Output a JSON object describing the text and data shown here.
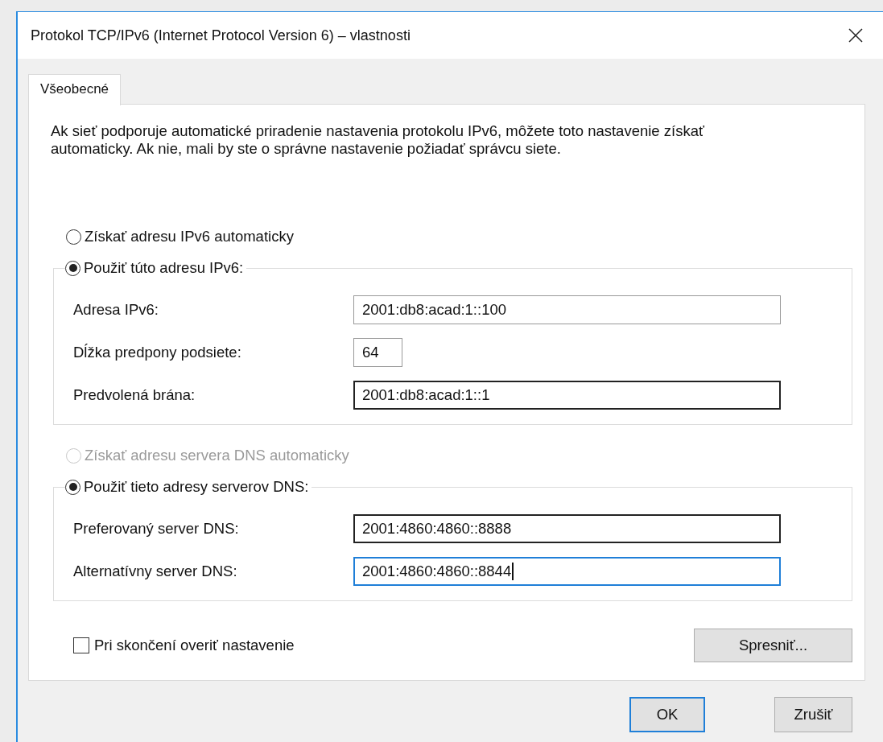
{
  "window": {
    "title": "Protokol TCP/IPv6 (Internet Protocol Version 6) – vlastnosti"
  },
  "tabs": [
    {
      "label": "Všeobecné",
      "selected": true
    }
  ],
  "description": "Ak sieť podporuje automatické priradenie nastavenia protokolu IPv6, môžete toto nastavenie získať automaticky. Ak nie, mali by ste o správne nastavenie požiadať správcu siete.",
  "address_group": {
    "auto_option": {
      "label": "Získať adresu IPv6 automaticky",
      "selected": false,
      "disabled": false
    },
    "manual_option": {
      "label": "Použiť túto adresu IPv6:",
      "selected": true,
      "disabled": false
    },
    "fields": [
      {
        "label": "Adresa IPv6:",
        "value": "2001:db8:acad:1::100",
        "kind": "long",
        "hovered": false,
        "focused": false
      },
      {
        "label": "Dĺžka predpony podsiete:",
        "value": "64",
        "kind": "short",
        "hovered": false,
        "focused": false
      },
      {
        "label": "Predvolená brána:",
        "value": "2001:db8:acad:1::1",
        "kind": "long",
        "hovered": true,
        "focused": false
      }
    ]
  },
  "dns_group": {
    "auto_option": {
      "label": "Získať adresu servera DNS automaticky",
      "selected": false,
      "disabled": true
    },
    "manual_option": {
      "label": "Použiť tieto adresy serverov DNS:",
      "selected": true,
      "disabled": false
    },
    "fields": [
      {
        "label": "Preferovaný server DNS:",
        "value": "2001:4860:4860::8888",
        "kind": "long",
        "hovered": true,
        "focused": false
      },
      {
        "label": "Alternatívny server DNS:",
        "value": "2001:4860:4860::8844",
        "kind": "long",
        "hovered": false,
        "focused": true
      }
    ]
  },
  "validate_checkbox": {
    "label": "Pri skončení overiť nastavenie",
    "checked": false
  },
  "advanced_button": "Spresniť...",
  "buttons": [
    {
      "label": "OK",
      "kind": "default"
    },
    {
      "label": "Zrušiť",
      "kind": "normal"
    }
  ]
}
